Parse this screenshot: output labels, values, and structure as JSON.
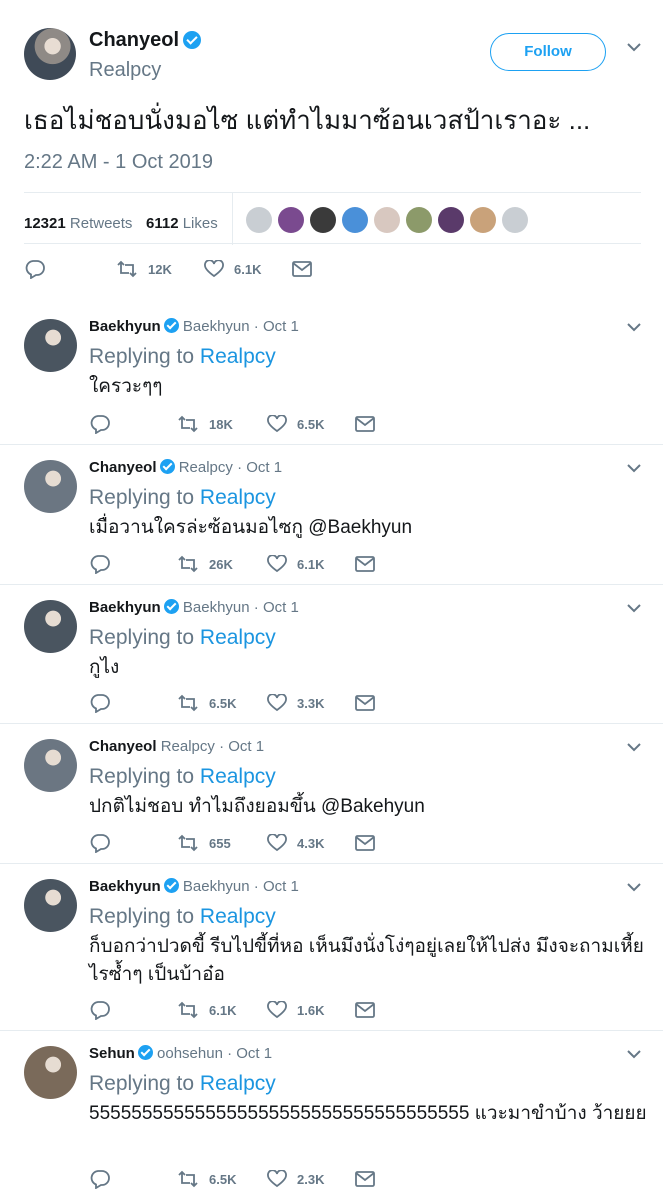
{
  "main": {
    "name": "Chanyeol",
    "handle": "Realpcy",
    "follow_label": "Follow",
    "text": "เธอไม่ชอบนั่งมอไซ แต่ทำไมมาซ้อนเวสป้าเราอะ ...",
    "timestamp": "2:22 AM - 1 Oct 2019",
    "retweets_count": "12321",
    "retweets_label": "Retweets",
    "likes_count": "6112",
    "likes_label": "Likes",
    "actions": {
      "retweets": "12K",
      "likes": "6.1K"
    },
    "liker_colors": [
      "#c9ced3",
      "#7a4a8f",
      "#3a3a3a",
      "#4a90d9",
      "#d8c8c0",
      "#8c9a6a",
      "#5a3a6a",
      "#c9a27a",
      "#c9ced3"
    ]
  },
  "replies": [
    {
      "name": "Baekhyun",
      "verified": true,
      "handle": "Baekhyun",
      "dot": "·",
      "date": "Oct 1",
      "replying_prefix": "Replying to",
      "replying_to": "Realpcy",
      "text": "ใครวะๆๆ",
      "retweets": "18K",
      "likes": "6.5K",
      "avatar_color": "#4a5560"
    },
    {
      "name": "Chanyeol",
      "verified": true,
      "handle": "Realpcy",
      "dot": "·",
      "date": "Oct 1",
      "replying_prefix": "Replying to",
      "replying_to": "Realpcy",
      "text": "เมื่อวานใครล่ะซ้อนมอไซกู @Baekhyun",
      "retweets": "26K",
      "likes": "6.1K",
      "avatar_color": "#6b7682"
    },
    {
      "name": "Baekhyun",
      "verified": true,
      "handle": "Baekhyun",
      "dot": "·",
      "date": "Oct 1",
      "replying_prefix": "Replying to",
      "replying_to": "Realpcy",
      "text": "กูไง",
      "retweets": "6.5K",
      "likes": "3.3K",
      "avatar_color": "#4a5560"
    },
    {
      "name": "Chanyeol",
      "verified": false,
      "handle": "Realpcy",
      "dot": "·",
      "date": "Oct 1",
      "replying_prefix": "Replying to",
      "replying_to": "Realpcy",
      "text": "ปกติไม่ชอบ ทำไมถึงยอมขึ้น @Bakehyun",
      "retweets": "655",
      "likes": "4.3K",
      "avatar_color": "#6b7682"
    },
    {
      "name": "Baekhyun",
      "verified": true,
      "handle": "Baekhyun",
      "dot": "·",
      "date": "Oct 1",
      "replying_prefix": "Replying to",
      "replying_to": "Realpcy",
      "text": "ก็บอกว่าปวดขี้ รีบไปขี้ที่หอ เห็นมึงนั่งโง่ๆอยู่เลยให้ไปส่ง มึงจะถามเหี้ยไรซ้ำๆ เป็นบ้าอ๋อ",
      "retweets": "6.1K",
      "likes": "1.6K",
      "avatar_color": "#4a5560"
    },
    {
      "name": "Sehun",
      "verified": true,
      "handle": "oohsehun",
      "dot": "·",
      "date": "Oct 1",
      "replying_prefix": "Replying to",
      "replying_to": "Realpcy",
      "text": "555555555555555555555555555555555555 แวะมาขำบ้าง ว้ายยย",
      "retweets": "6.5K",
      "likes": "2.3K",
      "avatar_color": "#7a6a5a"
    }
  ],
  "colors": {
    "accent": "#1da1f2",
    "link": "#1b95e0",
    "muted": "#657786",
    "text": "#14171a",
    "divider": "#e6ecf0"
  },
  "icons": [
    "caret-down-icon",
    "verified-badge-icon",
    "reply-icon",
    "retweet-icon",
    "like-icon",
    "message-icon"
  ]
}
